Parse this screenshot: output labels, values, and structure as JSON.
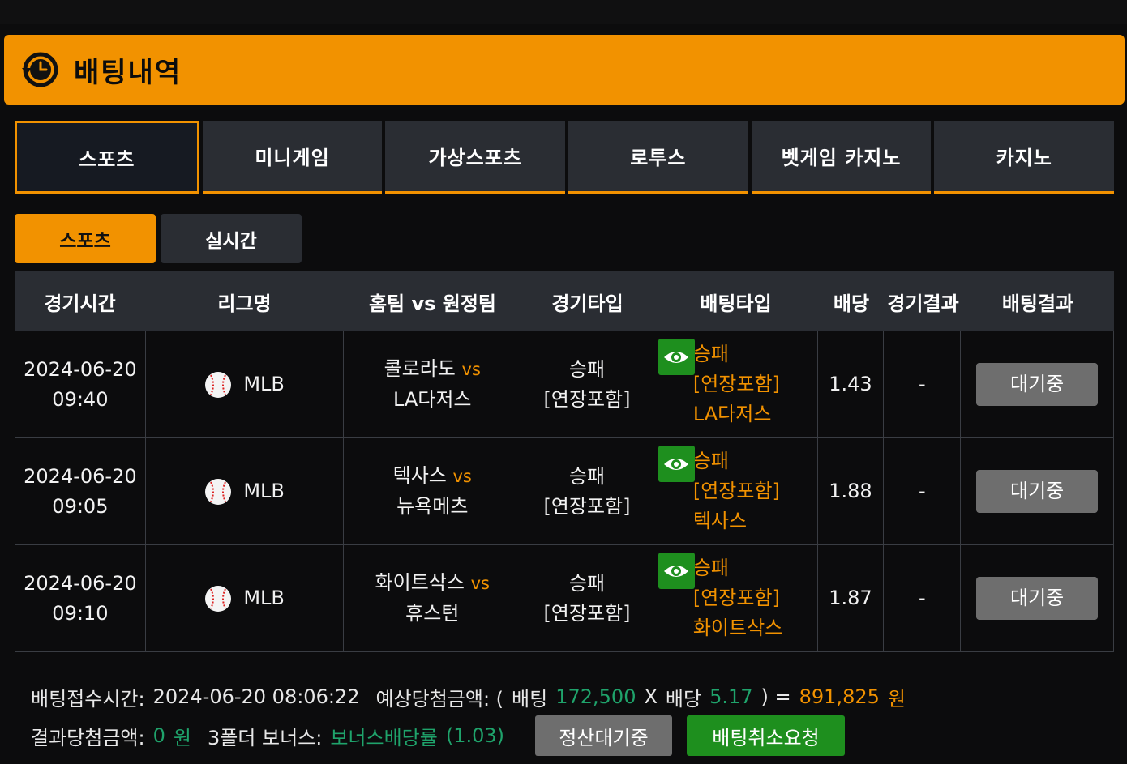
{
  "header": {
    "title": "배팅내역",
    "icon": "history-clock-icon"
  },
  "tabs": [
    {
      "label": "스포츠",
      "active": true
    },
    {
      "label": "미니게임",
      "active": false
    },
    {
      "label": "가상스포츠",
      "active": false
    },
    {
      "label": "로투스",
      "active": false
    },
    {
      "label": "벳게임 카지노",
      "active": false
    },
    {
      "label": "카지노",
      "active": false
    }
  ],
  "subtabs": [
    {
      "label": "스포츠",
      "active": true
    },
    {
      "label": "실시간",
      "active": false
    }
  ],
  "table": {
    "headers": [
      "경기시간",
      "리그명",
      "홈팀 vs 원정팀",
      "경기타입",
      "배팅타입",
      "배당",
      "경기결과",
      "배팅결과"
    ],
    "rows": [
      {
        "date": "2024-06-20",
        "time": "09:40",
        "league": "MLB",
        "home": "콜로라도",
        "vs": "vs",
        "away": "LA다저스",
        "type1": "승패",
        "type2": "[연장포함]",
        "bet1": "승패",
        "bet2": "[연장포함]",
        "bet3": "LA다저스",
        "odds": "1.43",
        "result": "-",
        "status": "대기중"
      },
      {
        "date": "2024-06-20",
        "time": "09:05",
        "league": "MLB",
        "home": "텍사스",
        "vs": "vs",
        "away": "뉴욕메츠",
        "type1": "승패",
        "type2": "[연장포함]",
        "bet1": "승패",
        "bet2": "[연장포함]",
        "bet3": "텍사스",
        "odds": "1.88",
        "result": "-",
        "status": "대기중"
      },
      {
        "date": "2024-06-20",
        "time": "09:10",
        "league": "MLB",
        "home": "화이트삭스",
        "vs": "vs",
        "away": "휴스턴",
        "type1": "승패",
        "type2": "[연장포함]",
        "bet1": "승패",
        "bet2": "[연장포함]",
        "bet3": "화이트삭스",
        "odds": "1.87",
        "result": "-",
        "status": "대기중"
      }
    ]
  },
  "footer": {
    "receipt_label": "배팅접수시간:",
    "receipt_time": "2024-06-20 08:06:22",
    "expected_label": "예상당첨금액: (",
    "bet_label": "배팅",
    "bet_amount": "172,500",
    "x_label": "X",
    "odds_label": "배당",
    "total_odds": "5.17",
    "equals_label": ") =",
    "expected_amount": "891,825",
    "won1": "원",
    "result_label": "결과당첨금액:",
    "result_amount": "0",
    "won2": "원",
    "bonus_label": "3폴더 보너스:",
    "bonus_value": "보너스배당률",
    "bonus_rate": "(1.03)",
    "settle_button": "정산대기중",
    "cancel_button": "배팅취소요청"
  },
  "colors": {
    "accent": "#f29200",
    "green_button": "#1e8f1e",
    "green_text": "#1fa36b",
    "panel": "#2a2d33",
    "background": "#0c0c0d"
  }
}
